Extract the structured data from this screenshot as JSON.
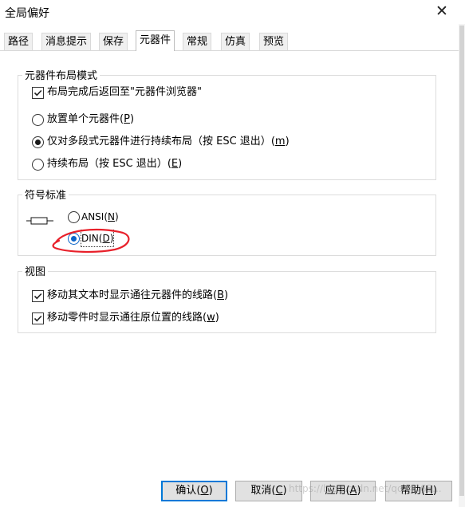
{
  "window": {
    "title": "全局偏好",
    "close_icon": "close-icon"
  },
  "tabs": [
    {
      "label": "路径",
      "active": false
    },
    {
      "label": "消息提示",
      "active": false
    },
    {
      "label": "保存",
      "active": false
    },
    {
      "label": "元器件",
      "active": true
    },
    {
      "label": "常规",
      "active": false
    },
    {
      "label": "仿真",
      "active": false
    },
    {
      "label": "预览",
      "active": false
    }
  ],
  "layout_mode": {
    "title": "元器件布局模式",
    "return_to_browser": {
      "label": "布局完成后返回至\"元器件浏览器\"",
      "checked": true
    },
    "options": [
      {
        "text": "放置单个元器件",
        "key": "P",
        "selected": false
      },
      {
        "text": "仅对多段式元器件进行持续布局（按 ESC 退出）",
        "key": "m",
        "selected": true
      },
      {
        "text": "持续布局（按 ESC 退出）",
        "key": "E",
        "selected": false
      }
    ]
  },
  "symbol_standard": {
    "title": "符号标准",
    "options": [
      {
        "text": "ANSI",
        "key": "N",
        "selected": false
      },
      {
        "text": "DIN",
        "key": "D",
        "selected": true
      }
    ],
    "annotation_color": "#e8202a"
  },
  "view": {
    "title": "视图",
    "items": [
      {
        "text": "移动其文本时显示通往元器件的线路",
        "key": "B",
        "checked": true
      },
      {
        "text": "移动零件时显示通往原位置的线路",
        "key": "w",
        "checked": true
      }
    ]
  },
  "buttons": [
    {
      "text": "确认",
      "key": "O",
      "default": true
    },
    {
      "text": "取消",
      "key": "C",
      "default": false
    },
    {
      "text": "应用",
      "key": "A",
      "default": false
    },
    {
      "text": "帮助",
      "key": "H",
      "default": false
    }
  ],
  "watermark": "https://blog.csdn.net/qq_4065...",
  "colors": {
    "accent": "#0078d7",
    "annotation": "#e8202a"
  }
}
